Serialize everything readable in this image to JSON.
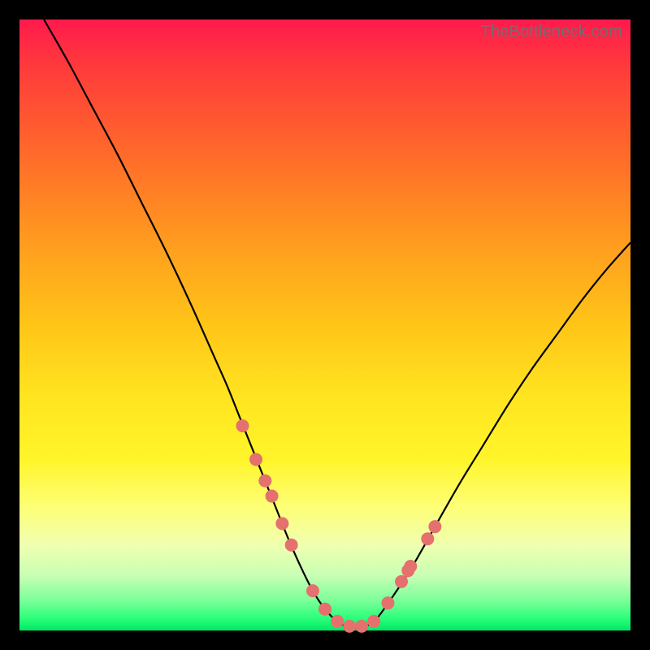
{
  "watermark": "TheBottleneck.com",
  "colors": {
    "marker": "#e4716e",
    "curve": "#000000"
  },
  "chart_data": {
    "type": "line",
    "title": "",
    "xlabel": "",
    "ylabel": "",
    "xlim": [
      0,
      100
    ],
    "ylim": [
      0,
      100
    ],
    "grid": false,
    "series": [
      {
        "name": "bottleneck-curve",
        "x": [
          4,
          8,
          12,
          16,
          20,
          24,
          28,
          32,
          34,
          36,
          38,
          40,
          42,
          44,
          46,
          48,
          50,
          52,
          54,
          56,
          58,
          60,
          64,
          68,
          72,
          76,
          80,
          84,
          88,
          92,
          96,
          100
        ],
        "y": [
          100,
          93,
          85.5,
          78,
          70,
          62,
          53.5,
          44.5,
          40,
          35,
          30,
          25,
          20,
          15,
          10.5,
          6.5,
          3.5,
          1.5,
          0.5,
          0.5,
          1.5,
          4,
          10,
          17,
          24,
          30.5,
          37,
          43,
          48.5,
          54,
          59,
          63.5
        ]
      }
    ],
    "markers": {
      "name": "highlight-points",
      "x": [
        36.5,
        38.7,
        40.2,
        41.3,
        43.0,
        44.5,
        48.0,
        50.0,
        52.0,
        54.0,
        56.0,
        58.0,
        60.3,
        62.5,
        63.6,
        64.0,
        66.8,
        68.0
      ],
      "y": [
        33.5,
        28.0,
        24.5,
        22.0,
        17.5,
        14.0,
        6.5,
        3.5,
        1.5,
        0.7,
        0.7,
        1.5,
        4.5,
        8.0,
        9.8,
        10.5,
        15.0,
        17.0
      ],
      "radius": 8
    }
  }
}
